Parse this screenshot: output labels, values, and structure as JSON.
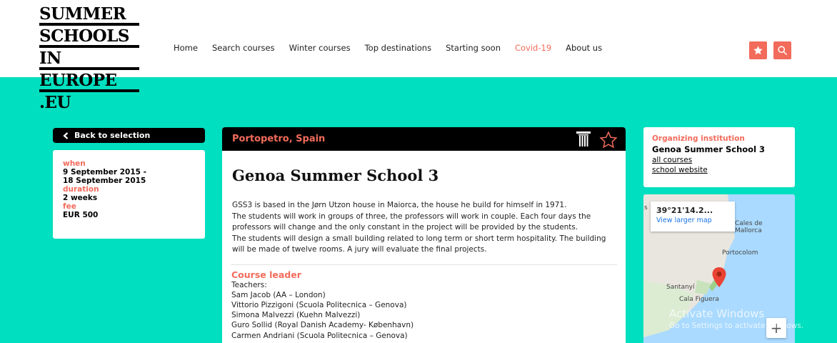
{
  "logo": {
    "lines": [
      "SUMMER",
      "SCHOOLS",
      "IN",
      "EUROPE",
      ".EU"
    ]
  },
  "nav": {
    "items": [
      {
        "label": "Home"
      },
      {
        "label": "Search courses"
      },
      {
        "label": "Winter courses"
      },
      {
        "label": "Top destinations"
      },
      {
        "label": "Starting soon"
      },
      {
        "label": "Covid-19"
      },
      {
        "label": "About us"
      }
    ]
  },
  "header_buttons": {
    "favorites_icon": "star-icon",
    "search_icon": "search-icon"
  },
  "colors": {
    "accent": "#f26b5b",
    "band": "#00dfbf",
    "black": "#000000"
  },
  "sidebar": {
    "back_label": "Back to selection",
    "when_label": "when",
    "when_value_1": "9 September 2015 -",
    "when_value_2": "18 September 2015",
    "duration_label": "duration",
    "duration_value": "2 weeks",
    "fee_label": "fee",
    "fee_value": "EUR 500"
  },
  "course": {
    "location": "Portopetro, Spain",
    "title": "Genoa Summer School 3",
    "description": [
      "GSS3 is based in the Jørn Utzon house in Maiorca, the house he build for himself in 1971.",
      "The students will work in groups of three, the professors will work in couple. Each four days the",
      "professors will change and the only constant in the project will be provided by the students.",
      "The students will design a small building related to long term or short term hospitality. The building",
      "will be made of twelve rooms. A jury will evaluate the final projects."
    ],
    "leader_title": "Course leader",
    "teachers_label": "Teachers:",
    "teachers": [
      "Sam Jacob (AA – London)",
      "Vittorio Pizzigoni (Scuola Politecnica – Genova)",
      "Simona Malvezzi (Kuehn Malvezzi)",
      "Guro Sollid (Royal Danish Academy- København)",
      "Carmen Andriani (Scuola Politecnica – Genova)"
    ]
  },
  "organizer": {
    "label": "Organizing institution",
    "name": "Genoa Summer School 3",
    "link_courses": "all courses",
    "link_website": "school website"
  },
  "map": {
    "coords": "39°21'14.2...",
    "view_larger": "View larger map",
    "places": [
      "Cales de",
      "Mallorca",
      "Portocolom",
      "Santanyí",
      "Cala Figuera"
    ],
    "edge_label": "s",
    "zoom_in": "+"
  },
  "watermark": {
    "title": "Activate Windows",
    "subtitle": "Go to Settings to activate Windows."
  }
}
